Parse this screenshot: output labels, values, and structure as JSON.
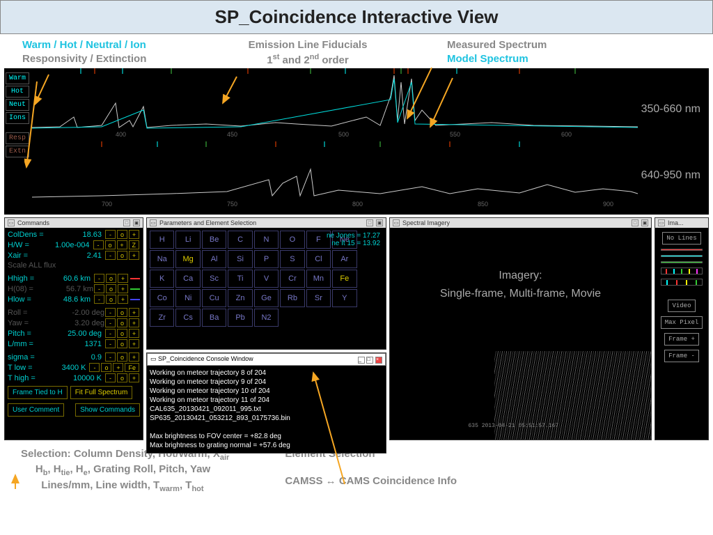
{
  "title": "SP_Coincidence Interactive View",
  "top_annotations": {
    "left_line1": "Warm / Hot / Neutral / Ion",
    "left_line2": "Responsivity / Extinction",
    "middle_line1": "Emission Line Fiducials",
    "middle_line2_p1": "1",
    "middle_line2_p2": " and 2",
    "middle_line2_p3": " order",
    "right_line1": "Measured Spectrum",
    "right_line2": "Model Spectrum"
  },
  "spectrum": {
    "label1": "350-660 nm",
    "label2": "640-950 nm",
    "side_buttons1": [
      "Warm",
      "Hot",
      "Neut",
      "Ions"
    ],
    "side_buttons2": [
      "Resp",
      "Extn"
    ]
  },
  "panels": {
    "commands_title": "Commands",
    "params_title": "Parameters and Element Selection",
    "imagery_title": "Spectral Imagery",
    "ima_title": "Ima...",
    "console_title": "SP_Coincidence Console Window"
  },
  "commands": {
    "coldens": {
      "label": "ColDens =",
      "val": "18.63"
    },
    "hw": {
      "label": "H/W  =",
      "val": "1.00e-004"
    },
    "xair": {
      "label": "Xair =",
      "val": "2.41"
    },
    "scale": "Scale ALL flux",
    "hhigh": {
      "label": "Hhigh =",
      "val": "60.6 km"
    },
    "h08": {
      "label": "H(08) =",
      "val": "56.7 km"
    },
    "hlow": {
      "label": "Hlow  =",
      "val": "48.6 km"
    },
    "roll": {
      "label": "Roll  =",
      "val": "-2.00 deg"
    },
    "yaw": {
      "label": "Yaw   =",
      "val": "3.20 deg"
    },
    "pitch": {
      "label": "Pitch =",
      "val": "25.00 deg"
    },
    "lmm": {
      "label": "L/mm  =",
      "val": "1371"
    },
    "sigma": {
      "label": "sigma =",
      "val": "0.9"
    },
    "tlow": {
      "label": "T low  =",
      "val": "3400 K"
    },
    "thigh": {
      "label": "T high =",
      "val": "10000 K"
    },
    "z_btn": "Z",
    "fe_btn": "Fe",
    "action1": "Frame Tied to H",
    "action2": "Fit Full Spectrum",
    "action3": "User Comment",
    "action4": "Show Commands"
  },
  "elements": [
    [
      "H",
      "Li",
      "Be",
      "C",
      "N",
      "O",
      "F",
      "Ne",
      ""
    ],
    [
      "Na",
      "Mg",
      "Al",
      "Si",
      "P",
      "S",
      "Cl",
      "Ar",
      ""
    ],
    [
      "K",
      "Ca",
      "Sc",
      "Ti",
      "V",
      "Cr",
      "Mn",
      "Fe",
      ""
    ],
    [
      "Co",
      "Ni",
      "Cu",
      "Zn",
      "Ge",
      "Rb",
      "Sr",
      "Y",
      ""
    ],
    [
      "Zr",
      "Cs",
      "Ba",
      "Pb",
      "N2",
      "",
      "",
      "",
      ""
    ]
  ],
  "element_highlights": [
    "Mg",
    "Fe"
  ],
  "ne_info": {
    "l1": "ne Jones = 17.27",
    "l2": "ne It 15 = 13.92"
  },
  "console_lines": [
    "Working on meteor trajectory 8 of 204",
    "Working on meteor trajectory 9 of 204",
    "Working on meteor trajectory 10 of 204",
    "Working on meteor trajectory 11 of 204",
    " CAL635_20130421_092011_995.txt",
    "  SP635_20130421_053212_893_0175736.bin",
    "",
    "Max brightness to FOV center     =  +82.8 deg",
    "Max brightness to grating normal =  +57.6 deg"
  ],
  "imagery": {
    "text1": "Imagery:",
    "text2": "Single-frame,  Multi-frame,  Movie",
    "timestamp": "635  2013-04-21  05:51:57.167"
  },
  "ima_buttons": {
    "nolines": "No Lines",
    "video": "Video",
    "maxpixel": "Max Pixel",
    "framep": "Frame +",
    "framem": "Frame -"
  },
  "bottom": {
    "col1_l1": "Selection:  Column Density,  Hot/Warm,  X",
    "col1_l1_sub": "air",
    "col1_l2_p1": "H",
    "col1_l2_s1": "b",
    "col1_l2_p2": ",  H",
    "col1_l2_s2": "tie",
    "col1_l2_p3": ",  H",
    "col1_l2_s3": "e",
    "col1_l2_p4": ",  Grating Roll, Pitch, Yaw",
    "col1_l3_p1": "Lines/mm,  Line width,  T",
    "col1_l3_s1": "warm",
    "col1_l3_p2": ",  T",
    "col1_l3_s2": "hot",
    "col2_l1": "Element Selection",
    "col2_l2": "CAMSS ↔ CAMS  Coincidence Info"
  }
}
